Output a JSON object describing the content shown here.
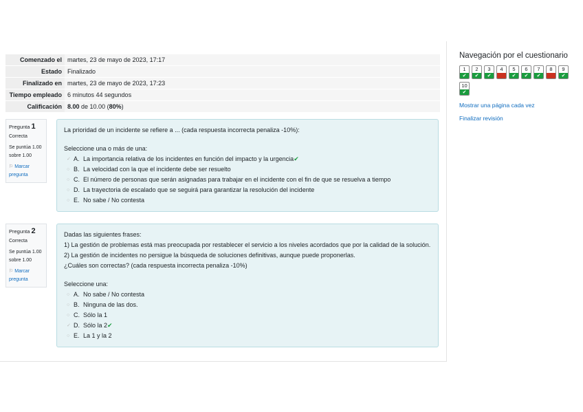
{
  "summary": [
    {
      "label": "Comenzado el",
      "value": "martes, 23 de mayo de 2023, 17:17"
    },
    {
      "label": "Estado",
      "value": "Finalizado"
    },
    {
      "label": "Finalizado en",
      "value": "martes, 23 de mayo de 2023, 17:23"
    },
    {
      "label": "Tiempo empleado",
      "value": "6 minutos 44 segundos"
    }
  ],
  "grade": {
    "label": "Calificación",
    "score": "8.00",
    "rest": " de 10.00 (",
    "pct": "80%",
    "close": ")"
  },
  "questions": [
    {
      "label": "Pregunta",
      "num": "1",
      "state": "Correcta",
      "points": "Se puntúa 1.00 sobre 1.00",
      "flag": "Marcar pregunta",
      "text": [
        "La prioridad de un incidente se refiere a ...  (cada respuesta incorrecta penaliza -10%):"
      ],
      "prompt": "Seleccione una o más de una:",
      "answers": [
        {
          "letter": "A.",
          "text": "La importancia relativa de los incidentes en función del impacto y la urgencia",
          "checked": true,
          "correct": true
        },
        {
          "letter": "B.",
          "text": "La velocidad con la que el incidente debe ser resuelto"
        },
        {
          "letter": "C.",
          "text": "El número de personas que serán asignadas para trabajar en el incidente con el fin de que se resuelva a tiempo"
        },
        {
          "letter": "D.",
          "text": "La trayectoria de escalado que se seguirá para garantizar la resolución del incidente"
        },
        {
          "letter": "E.",
          "text": "No sabe / No contesta"
        }
      ]
    },
    {
      "label": "Pregunta",
      "num": "2",
      "state": "Correcta",
      "points": "Se puntúa 1.00 sobre 1.00",
      "flag": "Marcar pregunta",
      "text": [
        "Dadas las siguientes frases:",
        "1) La gestión de problemas está mas preocupada por restablecer el servicio a los niveles acordados que por la calidad de la solución.",
        "2) La gestión de incidentes no persigue la búsqueda de soluciones definitivas, aunque puede proponerlas.",
        "¿Cuáles son correctas? (cada respuesta incorrecta penaliza -10%)"
      ],
      "prompt": "Seleccione una:",
      "answers": [
        {
          "letter": "A.",
          "text": "No sabe / No contesta"
        },
        {
          "letter": "B.",
          "text": "Ninguna de las dos."
        },
        {
          "letter": "C.",
          "text": "Sólo la 1"
        },
        {
          "letter": "D.",
          "text": "Sólo la 2",
          "checked": true,
          "correct": true
        },
        {
          "letter": "E.",
          "text": "La 1 y la 2"
        }
      ]
    }
  ],
  "nav": {
    "title": "Navegación por el cuestionario",
    "items": [
      {
        "n": "1",
        "ok": true
      },
      {
        "n": "2",
        "ok": true
      },
      {
        "n": "3",
        "ok": true
      },
      {
        "n": "4",
        "ok": false
      },
      {
        "n": "5",
        "ok": true
      },
      {
        "n": "6",
        "ok": true
      },
      {
        "n": "7",
        "ok": true
      },
      {
        "n": "8",
        "ok": false
      },
      {
        "n": "9",
        "ok": true
      },
      {
        "n": "10",
        "ok": true
      }
    ],
    "show_one_page": "Mostrar una página cada vez",
    "finish_review": "Finalizar revisión"
  },
  "colors": {
    "correct": "#1a9c3e",
    "incorrect": "#ca3120",
    "link": "#0f6cbf"
  }
}
